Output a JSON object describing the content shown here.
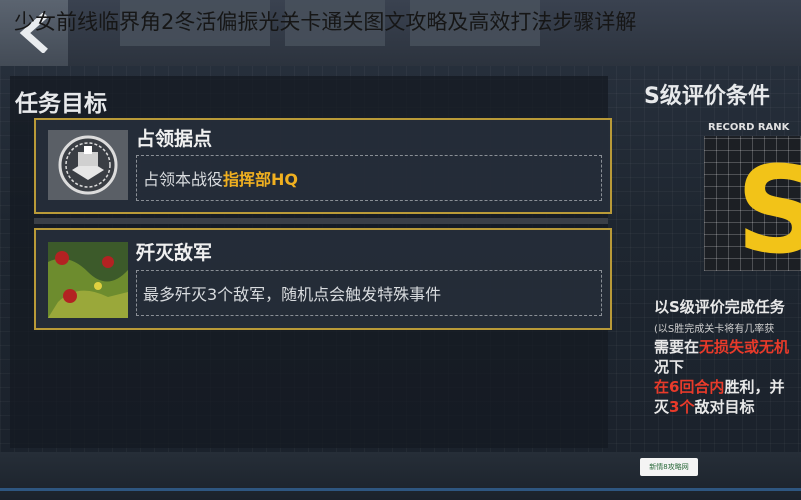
{
  "article_title": "少女前线临界角2冬活偏振光关卡通关图文攻略及高效打法步骤详解",
  "mission": {
    "title": "任务目标",
    "objectives": [
      {
        "name": "占领据点",
        "desc_prefix": "占领本战役",
        "desc_highlight": "指挥部HQ",
        "desc_suffix": "",
        "icon": "hq-building-icon"
      },
      {
        "name": "歼灭敌军",
        "desc_prefix": "最多歼灭3个敌军，随机点会触发特殊事件",
        "desc_highlight": "",
        "desc_suffix": "",
        "icon": "map-thumbnail-icon"
      }
    ]
  },
  "rank": {
    "title": "S级评价条件",
    "record_label": "RECORD RANK",
    "letter": "S",
    "line1": "以S级评价完成任务",
    "line2": "(以S胜完成关卡将有几率获",
    "line3_prefix": "需要在",
    "line3_highlight": "无损失或无机",
    "line4": "况下",
    "line5_highlight": "在6回合内",
    "line5_suffix": "胜利，并",
    "line6_prefix": "灭",
    "line6_highlight": "3个",
    "line6_suffix": "敌对目标"
  },
  "watermark": "新情8攻略网",
  "colors": {
    "accent_gold": "#b99a38",
    "highlight": "#f0b020",
    "rank_yellow": "#f2c318",
    "red": "#e83a2a"
  }
}
